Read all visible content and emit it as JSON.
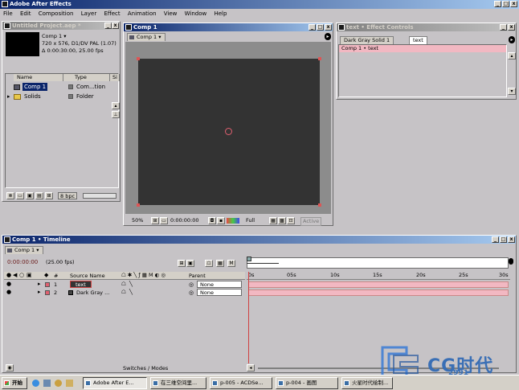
{
  "app": {
    "title": "Adobe After Effects",
    "menu": [
      "File",
      "Edit",
      "Composition",
      "Layer",
      "Effect",
      "Animation",
      "View",
      "Window",
      "Help"
    ]
  },
  "project": {
    "window_title": "Untitled Project.aep *",
    "comp_name": "Comp 1 ▾",
    "info_line1": "720 x 576, D1/DV PAL (1.07)",
    "info_line2": "Δ 0:00:30:00, 25.00 fps",
    "columns": [
      "Name",
      "Type",
      "Si"
    ],
    "items": [
      {
        "name": "Comp 1",
        "type": "Com...tion",
        "selected": true
      },
      {
        "name": "Solids",
        "type": "Folder",
        "selected": false
      }
    ],
    "bit_depth": "8 bpc"
  },
  "comp_viewer": {
    "window_title": "Comp 1",
    "tab_label": "Comp 1 ▾",
    "zoom": "50%",
    "timecode": "0:00:00:00",
    "resolution": "Full",
    "active_camera": "Active"
  },
  "effect_controls": {
    "window_title": "text • Effect Controls",
    "tabs": [
      "Dark Gray Solid 1",
      "text"
    ],
    "header": "Comp 1 • text"
  },
  "timeline": {
    "window_title": "Comp 1 • Timeline",
    "tab_label": "Comp 1 ▾",
    "timecode": "0:00:00:00",
    "fps": "(25.00 fps)",
    "columns": {
      "num": "#",
      "source": "Source Name",
      "parent": "Parent"
    },
    "ruler": [
      "0s",
      "05s",
      "10s",
      "15s",
      "20s",
      "25s",
      "30s"
    ],
    "layers": [
      {
        "num": "1",
        "name": "text",
        "parent": "None",
        "selected": true
      },
      {
        "num": "2",
        "name": "Dark Gray ...",
        "parent": "None",
        "selected": false
      }
    ],
    "switches_modes": "Switches / Modes"
  },
  "taskbar": {
    "start": "开始",
    "items": [
      "Adobe After E...",
      "在三维空间里...",
      "p-005 - ACDSe...",
      "p-004 - 画图",
      "火星时代绘制..."
    ]
  },
  "watermark": {
    "brand": "CG时代",
    "site": "2991"
  },
  "colors": {
    "titlebar_active": "#0a246a",
    "comp_bg": "#333333",
    "layer_bar": "#f2b8c2",
    "window_gray": "#c6c3c6"
  }
}
